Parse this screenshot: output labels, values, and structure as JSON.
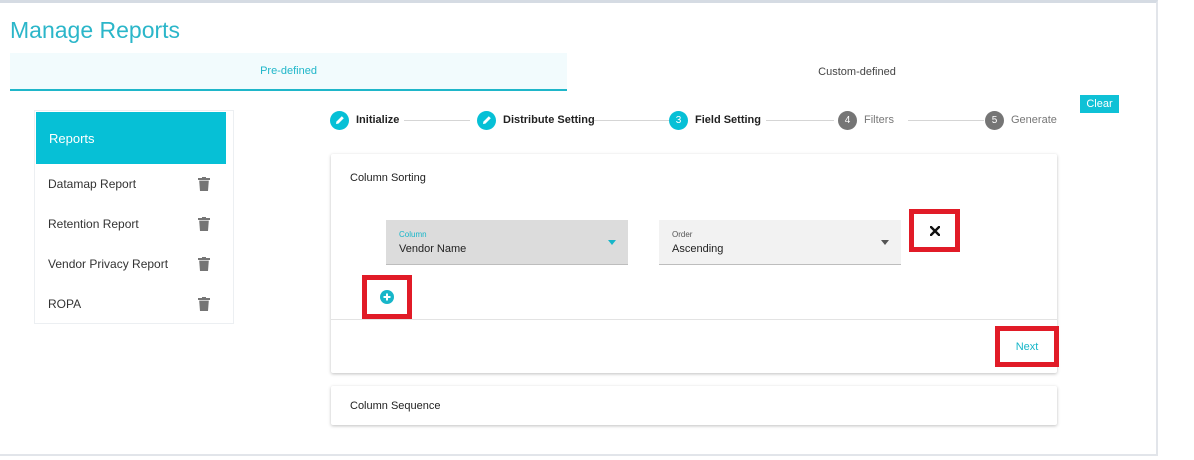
{
  "page": {
    "title": "Manage Reports"
  },
  "tabs": [
    {
      "label": "Pre-defined",
      "active": true
    },
    {
      "label": "Custom-defined",
      "active": false
    }
  ],
  "toolbar": {
    "clear_label": "Clear"
  },
  "sidebar": {
    "header": "Reports",
    "items": [
      {
        "label": "Datamap Report"
      },
      {
        "label": "Retention Report"
      },
      {
        "label": "Vendor Privacy Report"
      },
      {
        "label": "ROPA"
      }
    ]
  },
  "stepper": {
    "steps": [
      {
        "number": "",
        "label": "Initialize",
        "state": "done"
      },
      {
        "number": "",
        "label": "Distribute Setting",
        "state": "done"
      },
      {
        "number": "3",
        "label": "Field Setting",
        "state": "current"
      },
      {
        "number": "4",
        "label": "Filters",
        "state": "pending"
      },
      {
        "number": "5",
        "label": "Generate",
        "state": "pending"
      }
    ]
  },
  "column_sorting": {
    "title": "Column Sorting",
    "column": {
      "label": "Column",
      "value": "Vendor Name"
    },
    "order": {
      "label": "Order",
      "value": "Ascending"
    },
    "next_label": "Next"
  },
  "column_sequence": {
    "title": "Column Sequence"
  },
  "colors": {
    "accent": "#06c0d6",
    "highlight": "#e11b27",
    "title": "#2bb6c9"
  }
}
